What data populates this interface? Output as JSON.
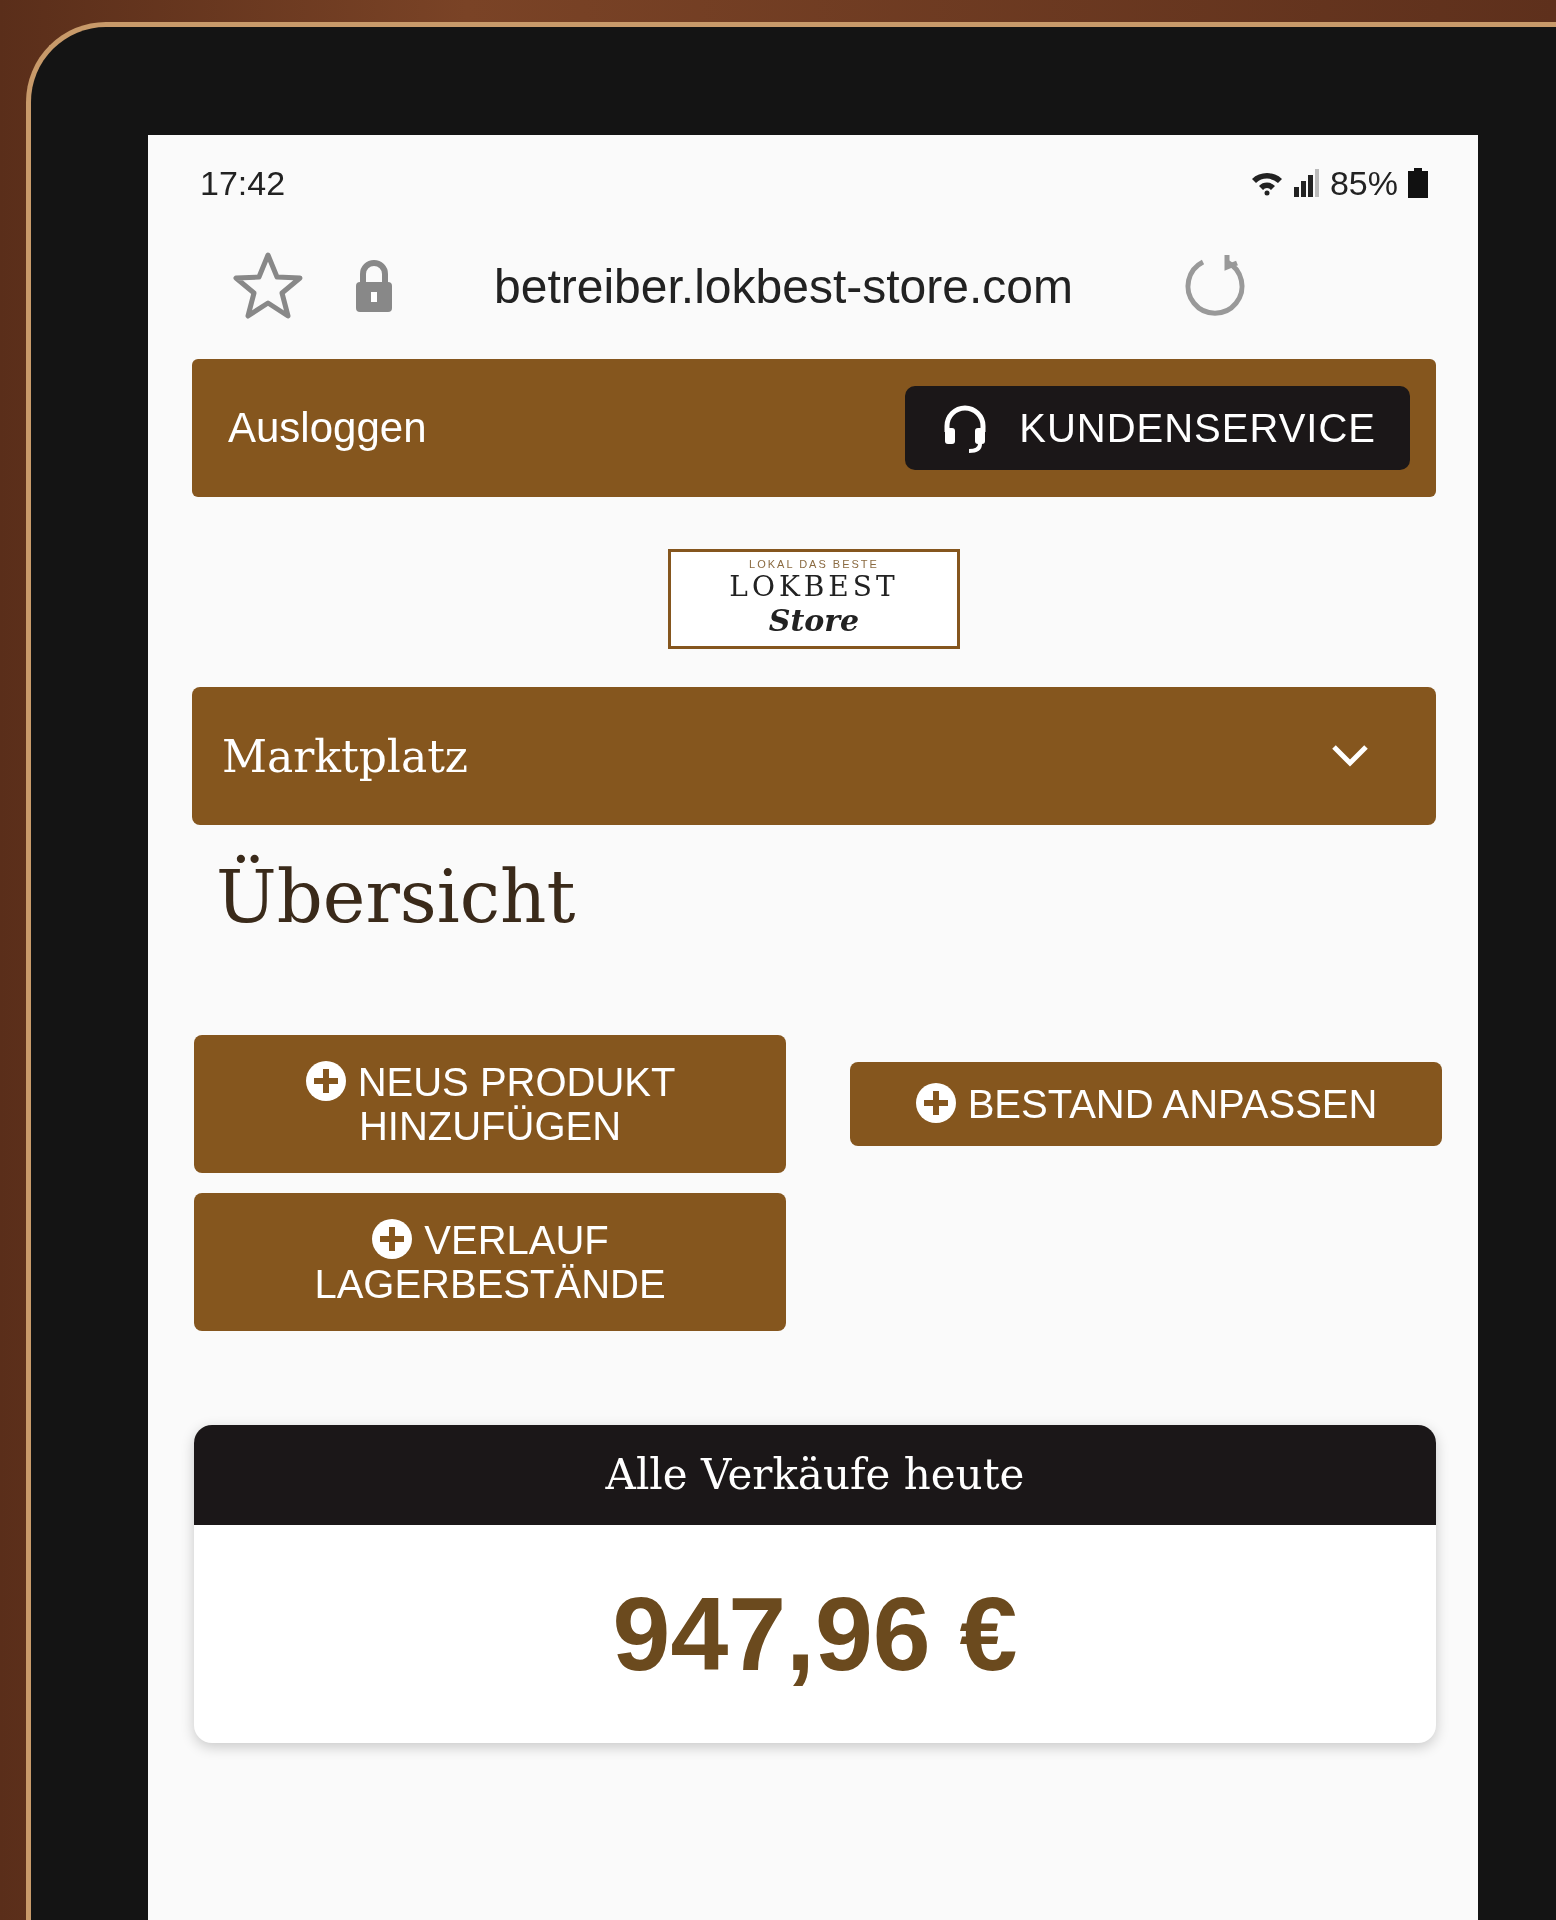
{
  "status_bar": {
    "time": "17:42",
    "battery": "85%"
  },
  "browser": {
    "url": "betreiber.lokbest-store.com"
  },
  "top_bar": {
    "logout": "Ausloggen",
    "support_button": "KUNDENSERVICE"
  },
  "logo": {
    "tagline": "LOKAL DAS BESTE",
    "name": "LOKBEST",
    "script": "Store"
  },
  "nav": {
    "label": "Marktplatz",
    "expanded": false
  },
  "heading": "Übersicht",
  "actions": [
    {
      "label": "NEUS PRODUKT HINZUFÜGEN"
    },
    {
      "label": "BESTAND ANPASSEN"
    },
    {
      "label": "VERLAUF LAGERBESTÄNDE"
    }
  ],
  "sales_card": {
    "title": "Alle Verkäufe heute",
    "amount": "947,96 €"
  }
}
